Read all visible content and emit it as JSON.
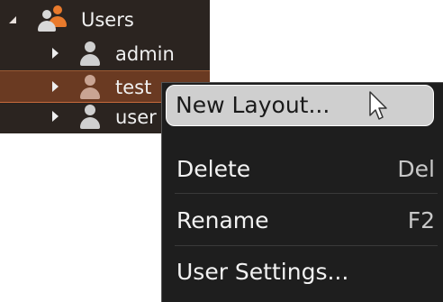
{
  "tree": {
    "group": {
      "label": "Users",
      "icon": "group-users-icon",
      "expanded": true
    },
    "children": [
      {
        "label": "admin",
        "icon": "user-icon",
        "selected": false
      },
      {
        "label": "test",
        "icon": "user-icon",
        "selected": true
      },
      {
        "label": "user",
        "icon": "user-icon",
        "selected": false
      }
    ]
  },
  "context_menu": {
    "items": [
      {
        "label": "New Layout...",
        "shortcut": "",
        "highlighted": true
      },
      {
        "label": "Delete",
        "shortcut": "Del"
      },
      {
        "label": "Rename",
        "shortcut": "F2"
      },
      {
        "label": "User Settings...",
        "shortcut": ""
      }
    ]
  },
  "colors": {
    "tree_background": "#2b2420",
    "selection": "#6a3a22",
    "group_icon_accent": "#e97a2c",
    "menu_background": "#1e1e1e",
    "menu_highlight": "#cfcfcf"
  }
}
